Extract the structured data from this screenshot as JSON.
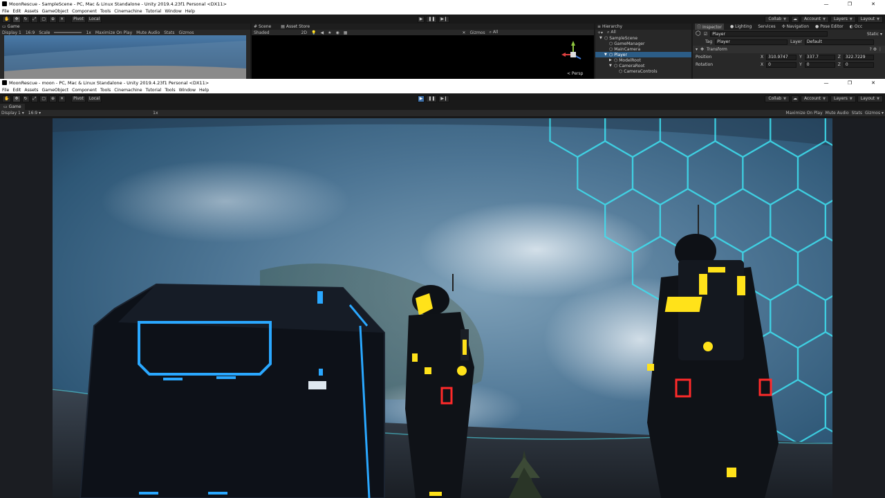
{
  "back_window": {
    "title": "MoonRescue - SampleScene - PC, Mac & Linux Standalone - Unity 2019.4.23f1 Personal <DX11>",
    "menu": [
      "File",
      "Edit",
      "Assets",
      "GameObject",
      "Component",
      "Tools",
      "Cinemachine",
      "Tutorial",
      "Window",
      "Help"
    ],
    "toolbar": {
      "pivot": "Pivot",
      "local": "Local",
      "collab": "Collab",
      "account": "Account",
      "layers": "Layers",
      "layout": "Layout"
    },
    "game_tab": "Game",
    "game_sub": {
      "display": "Display 1",
      "aspect": "16:9",
      "scale_label": "Scale",
      "scale_value": "1x",
      "maximize": "Maximize On Play",
      "mute": "Mute Audio",
      "stats": "Stats",
      "gizmos": "Gizmos"
    },
    "scene_tabs": [
      "Scene",
      "Asset Store"
    ],
    "scene_sub": {
      "shaded": "Shaded",
      "mode2d": "2D",
      "gizmos": "Gizmos",
      "search": "All"
    },
    "persp_label": "< Persp",
    "hierarchy": {
      "tab": "Hierarchy",
      "search": "All",
      "rows": [
        {
          "label": "SampleScene",
          "indent": 0,
          "selected": false,
          "toggle": "▼"
        },
        {
          "label": "GameManager",
          "indent": 1,
          "selected": false,
          "toggle": ""
        },
        {
          "label": "MainCamera",
          "indent": 1,
          "selected": false,
          "toggle": ""
        },
        {
          "label": "Player",
          "indent": 1,
          "selected": true,
          "toggle": "▼"
        },
        {
          "label": "ModelRoot",
          "indent": 2,
          "selected": false,
          "toggle": "▶"
        },
        {
          "label": "CameraRoot",
          "indent": 2,
          "selected": false,
          "toggle": "▼"
        },
        {
          "label": "CameraControls",
          "indent": 3,
          "selected": false,
          "toggle": ""
        }
      ]
    },
    "inspector": {
      "tabs": [
        "Inspector",
        "Lighting",
        "Services",
        "Navigation",
        "Pose Editor",
        "Occ"
      ],
      "object_name": "Player",
      "static_label": "Static",
      "tag_label": "Tag",
      "tag_value": "Player",
      "layer_label": "Layer",
      "layer_value": "Default",
      "component": "Transform",
      "position_label": "Position",
      "position": {
        "x": "310.9747",
        "y": "337.7",
        "z": "322.7229"
      },
      "rotation_label": "Rotation",
      "rotation": {
        "x": "0",
        "y": "0",
        "z": "0"
      }
    }
  },
  "front_window": {
    "title": "MoonRescue - moon - PC, Mac & Linux Standalone - Unity 2019.4.23f1 Personal <DX11>",
    "menu": [
      "File",
      "Edit",
      "Assets",
      "GameObject",
      "Component",
      "Tools",
      "Cinemachine",
      "Tutorial",
      "Tools",
      "Window",
      "Help"
    ],
    "toolbar": {
      "pivot": "Pivot",
      "local": "Local",
      "collab": "Collab",
      "account": "Account",
      "layers": "Layers",
      "layout": "Layout"
    },
    "game_tab": "Game",
    "game_sub": {
      "display": "Display 1",
      "aspect": "16:9",
      "scale_value": "1x",
      "maximize": "Maximize On Play",
      "mute": "Mute Audio",
      "stats": "Stats",
      "gizmos": "Gizmos"
    }
  },
  "colors": {
    "hex_grid": "#3fe0f0",
    "accent_yellow": "#ffe21a",
    "accent_blue": "#2aa8ff",
    "accent_red": "#ff2a2a",
    "selection": "#2c5d87"
  }
}
